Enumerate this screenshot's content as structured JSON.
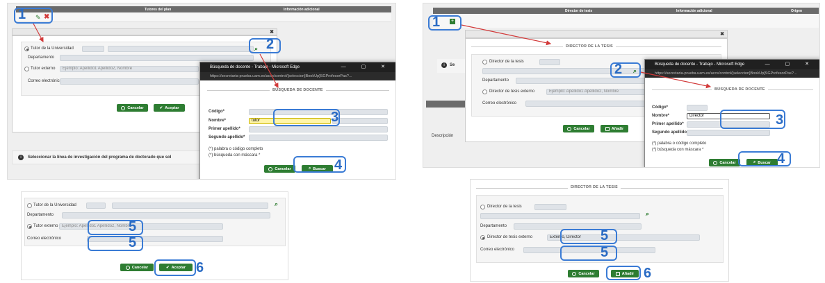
{
  "colors": {
    "highlight": "#3a7bd5",
    "accent_green": "#2e7d32",
    "arrow": "#d23a3a",
    "header": "#6b6b6b"
  },
  "steps": {
    "s1": "1",
    "s2": "2",
    "s3": "3",
    "s4": "4",
    "s5": "5",
    "s6": "6"
  },
  "left": {
    "header": {
      "col1": "Tutores del plan",
      "col2": "Información adicional"
    },
    "form": {
      "tutor_uni": "Tutor de la Universidad",
      "departamento": "Departamento",
      "tutor_externo": "Tutor externo",
      "externo_placeholder": "Ejemplo: Apellido1 Apellido2, Nombre",
      "correo": "Correo electrónico",
      "cancel": "Cancelar",
      "accept": "Aceptar"
    },
    "popup": {
      "title": "Búsqueda de docente - Trabajo - Microsoft Edge",
      "url": "https://secretaria-prueba.uam.es/accs/control/[seleccion]BookUp]SGProfesorPas?...",
      "section": "BÚSQUEDA DE DOCENTE",
      "codigo": "Código*",
      "nombre": "Nombre*",
      "nombre_value": "tutor",
      "primer": "Primer apellido*",
      "segundo": "Segundo apellido*",
      "note1": "(*) palabra o código completo",
      "note2": "(*) búsqueda con máscara *",
      "cancel": "Cancelar",
      "search": "Buscar"
    },
    "info_line": "Seleccionar la línea de investigación del programa de doctorado que sol",
    "bottom": {
      "tutor_uni": "Tutor de la Universidad",
      "departamento": "Departamento",
      "tutor_externo": "Tutor externo",
      "placeholder": "Ejemplo: Apellido1 Apellido2, Nombre",
      "correo": "Correo electrónico",
      "cancel": "Cancelar",
      "accept": "Aceptar"
    }
  },
  "right": {
    "header": {
      "col1": "Director de tesis",
      "col2": "Información adicional",
      "col3": "Origen"
    },
    "section": "DIRECTOR DE LA TESIS",
    "form": {
      "director": "Director de la tesis",
      "departamento": "Departamento",
      "externo": "Director de tesis externo",
      "placeholder": "Ejemplo: Apellido1 Apellido2, Nombre",
      "correo": "Correo electrónico",
      "cancel": "Cancelar",
      "add": "Añadir"
    },
    "se": "Se",
    "descripcion": "Descripción",
    "popup": {
      "title": "Búsqueda de docente - Trabajo - Microsoft Edge",
      "url": "https://secretaria-prueba.uam.es/accs/control/[seleccion]BookUp]SGProfesorPas?...",
      "section": "BÚSQUEDA DE DOCENTE",
      "codigo": "Código*",
      "nombre": "Nombre*",
      "nombre_value": "Director",
      "primer": "Primer apellido*",
      "segundo": "Segundo apellido*",
      "note1": "(*) palabra o código completo",
      "note2": "(*) búsqueda con máscara *",
      "cancel": "Cancelar",
      "search": "Buscar"
    },
    "bottom": {
      "section": "DIRECTOR DE LA TESIS",
      "director": "Director de la tesis",
      "departamento": "Departamento",
      "externo": "Director de tesis externo",
      "externo_value": "Externo, Director",
      "correo": "Correo electrónico",
      "cancel": "Cancelar",
      "add": "Añadir"
    }
  }
}
